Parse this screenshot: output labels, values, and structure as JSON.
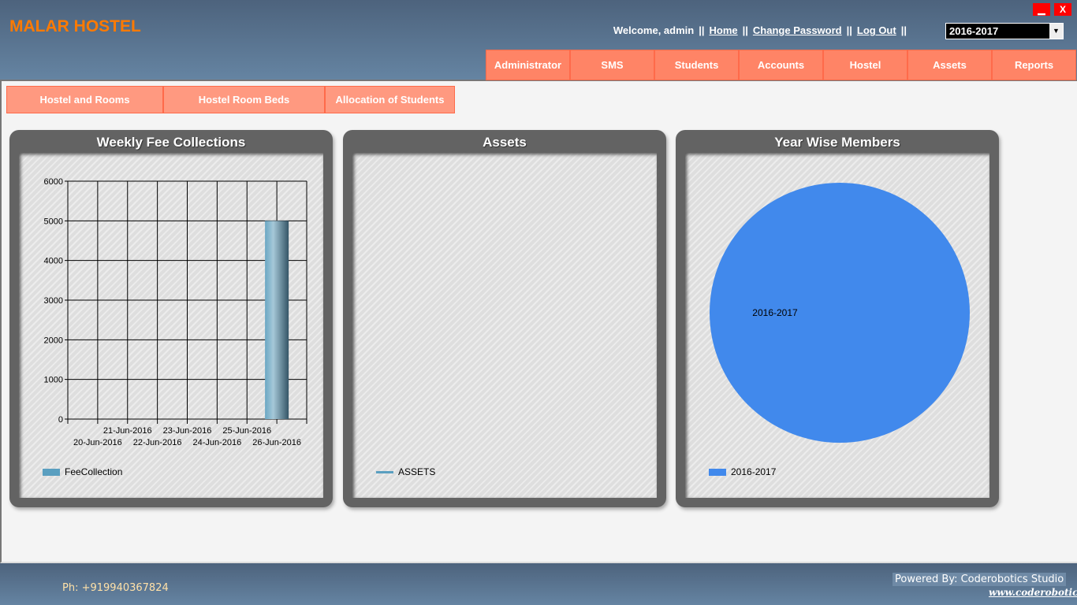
{
  "header": {
    "title": "MALAR HOSTEL",
    "welcome": "Welcome, admin",
    "home": "Home",
    "change_password": "Change Password",
    "logout": "Log Out",
    "separator": "||",
    "year": "2016-2017",
    "minimize": "▁",
    "close": "X"
  },
  "nav": [
    "Administrator",
    "SMS",
    "Students",
    "Accounts",
    "Hostel",
    "Assets",
    "Reports"
  ],
  "subnav": [
    "Hostel and Rooms",
    "Hostel Room Beds",
    "Allocation of Students"
  ],
  "panels": {
    "fee": "Weekly Fee Collections",
    "assets": "Assets",
    "year": "Year Wise Members"
  },
  "legends": {
    "fee": "FeeCollection",
    "assets": "ASSETS",
    "year": "2016-2017"
  },
  "colors": {
    "accent": "#ff8466",
    "pie": "#4189ec",
    "bar": "#5a9fc0"
  },
  "chart_data": [
    {
      "type": "bar",
      "title": "Weekly Fee Collections",
      "categories": [
        "20-Jun-2016",
        "21-Jun-2016",
        "22-Jun-2016",
        "23-Jun-2016",
        "24-Jun-2016",
        "25-Jun-2016",
        "26-Jun-2016"
      ],
      "series": [
        {
          "name": "FeeCollection",
          "values": [
            0,
            0,
            0,
            0,
            0,
            0,
            5000
          ]
        }
      ],
      "yticks": [
        0,
        1000,
        2000,
        3000,
        4000,
        5000,
        6000
      ],
      "ylim": [
        0,
        6000
      ],
      "grid": true,
      "legend": "bottom-left"
    },
    {
      "type": "line",
      "title": "Assets",
      "series": [
        {
          "name": "ASSETS",
          "values": []
        }
      ],
      "legend": "bottom-left"
    },
    {
      "type": "pie",
      "title": "Year Wise Members",
      "labels": [
        "2016-2017"
      ],
      "values": [
        100
      ],
      "legend": "bottom-left"
    }
  ],
  "footer": {
    "phone": "Ph: +919940367824",
    "powered": "Powered By: Coderobotics Studio",
    "website": "www.coderobotics"
  }
}
